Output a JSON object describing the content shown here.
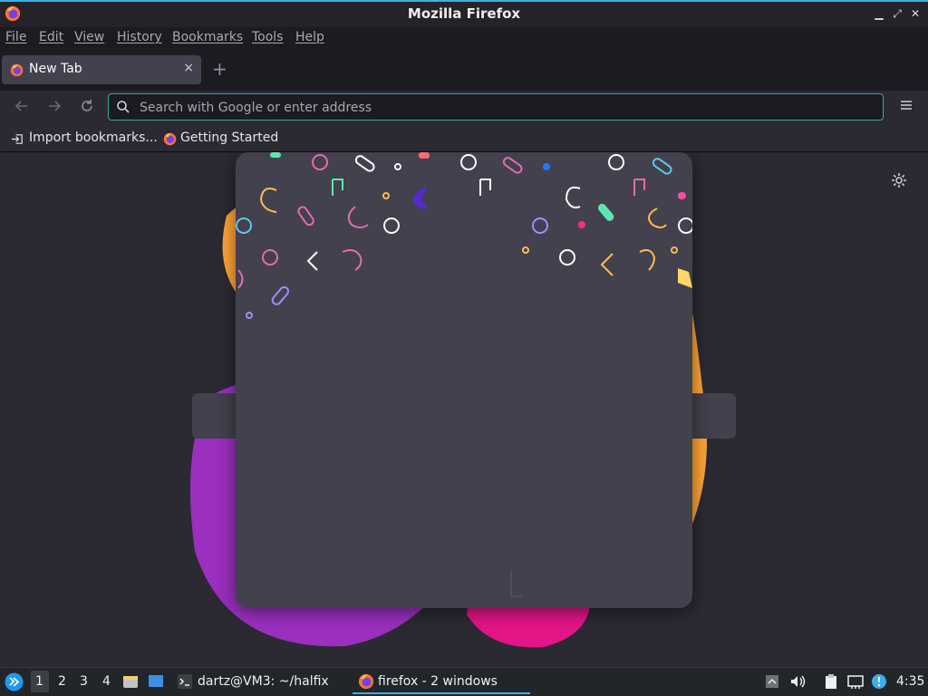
{
  "window": {
    "title": "Mozilla Firefox"
  },
  "menubar": {
    "items": [
      "File",
      "Edit",
      "View",
      "History",
      "Bookmarks",
      "Tools",
      "Help"
    ]
  },
  "tabs": [
    {
      "label": "New Tab",
      "close": "×"
    }
  ],
  "newtab_label": "+",
  "urlbar": {
    "placeholder": "Search with Google or enter address",
    "value": ""
  },
  "bookmarks": [
    {
      "label": "Import bookmarks..."
    },
    {
      "label": "Getting Started"
    }
  ],
  "taskbar": {
    "workspaces": [
      "1",
      "2",
      "3",
      "4"
    ],
    "active_workspace": "1",
    "tasks": [
      {
        "label": "dartz@VM3: ~/halfix",
        "icon": "terminal-icon"
      },
      {
        "label": "firefox - 2 windows",
        "icon": "firefox-icon",
        "active": true
      }
    ],
    "clock": "4:35"
  },
  "colors": {
    "accent": "#3daee9",
    "urlbar_focus": "#3fa59e",
    "blob_orange": "#ffa436",
    "blob_purple": "#9b2fbf",
    "blob_pink": "#e31587"
  }
}
